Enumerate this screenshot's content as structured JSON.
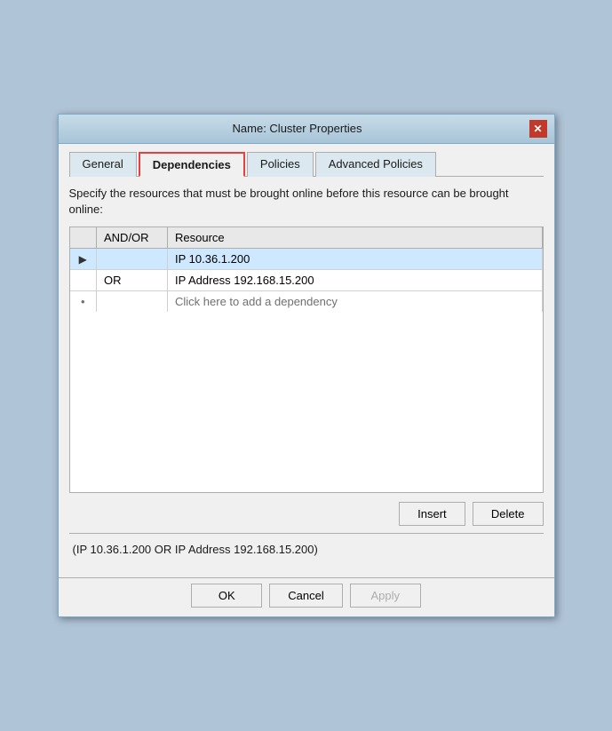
{
  "dialog": {
    "title": "Name: Cluster Properties"
  },
  "tabs": [
    {
      "label": "General",
      "active": false
    },
    {
      "label": "Dependencies",
      "active": true
    },
    {
      "label": "Policies",
      "active": false
    },
    {
      "label": "Advanced Policies",
      "active": false
    }
  ],
  "description": "Specify the resources that must be brought online before this resource can be brought online:",
  "table": {
    "columns": [
      {
        "label": ""
      },
      {
        "label": "AND/OR"
      },
      {
        "label": "Resource"
      }
    ],
    "rows": [
      {
        "selector": "▶",
        "andor": "",
        "resource": "IP 10.36.1.200",
        "selected": true
      },
      {
        "selector": "",
        "andor": "OR",
        "resource": "IP Address 192.168.15.200",
        "selected": false
      }
    ],
    "add_row": {
      "dot": "•",
      "text": "Click here to add a dependency"
    }
  },
  "buttons": {
    "insert": "Insert",
    "delete": "Delete"
  },
  "dependency_expression": "(IP 10.36.1.200  OR  IP Address 192.168.15.200)",
  "bottom_buttons": {
    "ok": "OK",
    "cancel": "Cancel",
    "apply": "Apply"
  }
}
